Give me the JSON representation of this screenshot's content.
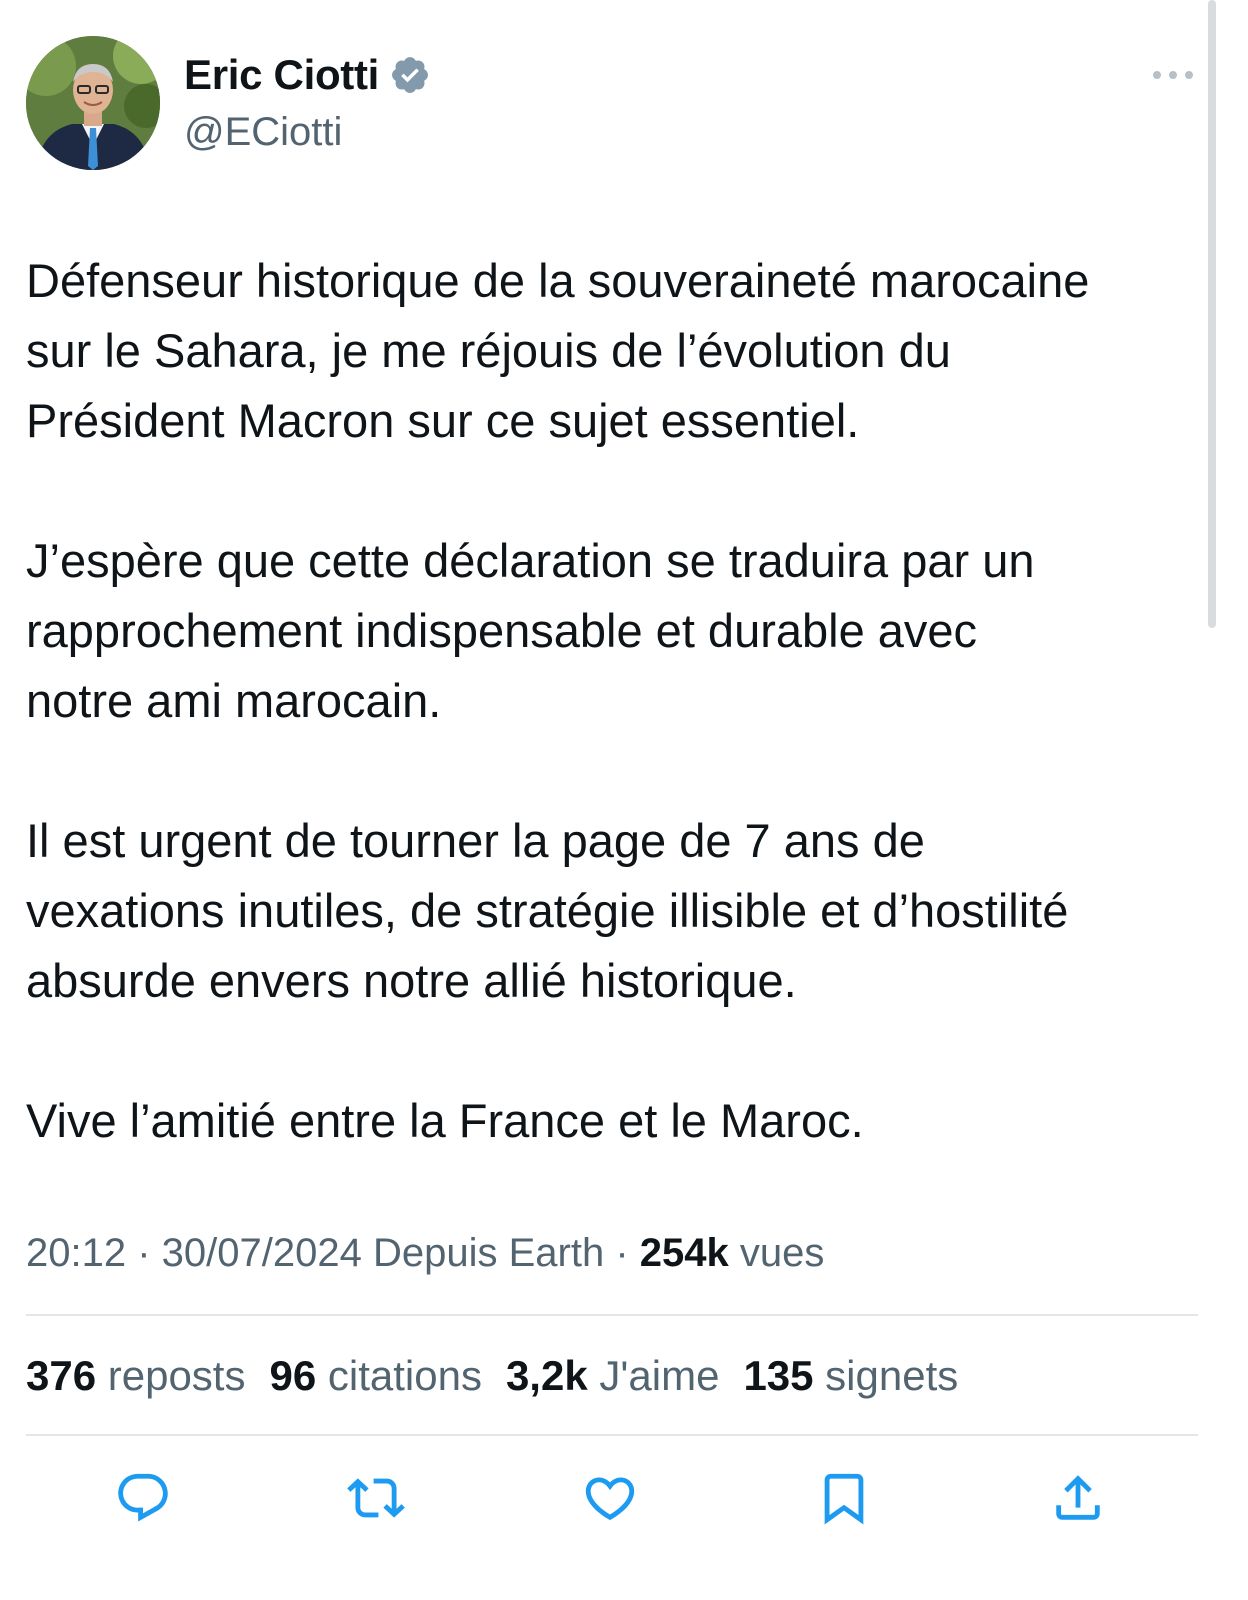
{
  "author": {
    "name": "Eric Ciotti",
    "handle": "@ECiotti",
    "verified": true
  },
  "tweet": {
    "paragraphs": [
      "Défenseur historique de la souveraineté marocaine\nsur le Sahara, je me réjouis de l’évolution du\nPrésident Macron sur ce sujet essentiel.",
      "J’espère que cette déclaration se traduira par un\nrapprochement indispensable et durable avec\nnotre ami marocain.",
      "Il est urgent de tourner la page de 7 ans de\nvexations inutiles, de stratégie illisible et d’hostilité\nabsurde envers notre allié historique.",
      "Vive l’amitié entre la France et le Maroc."
    ]
  },
  "meta": {
    "time": "20:12",
    "sep1": " · ",
    "date": "30/07/2024",
    "source": " Depuis Earth",
    "sep2": " · ",
    "views_count": "254k",
    "views_label": " vues"
  },
  "stats": {
    "reposts": {
      "count": "376",
      "label": " reposts"
    },
    "quotes": {
      "count": "96",
      "label": " citations"
    },
    "likes": {
      "count": "3,2k",
      "label": " J'aime"
    },
    "bookmarks": {
      "count": "135",
      "label": " signets"
    }
  },
  "actions": [
    "reply-icon",
    "repost-icon",
    "like-icon",
    "bookmark-icon",
    "share-icon"
  ],
  "colors": {
    "text_primary": "#0f1419",
    "text_secondary": "#536471",
    "verified_badge": "#829aab",
    "action_icon": "#1d9bf0",
    "divider": "#e3e7ea"
  }
}
